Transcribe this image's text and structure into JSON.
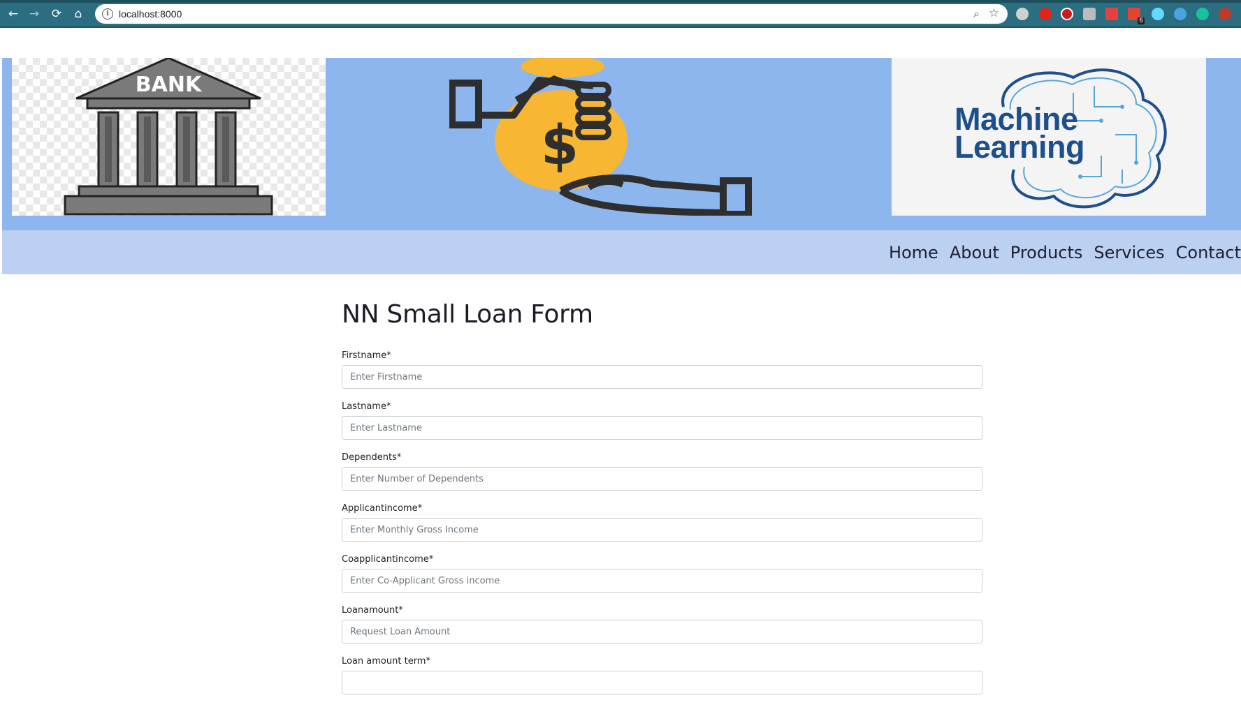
{
  "browser": {
    "url": "localhost:8000",
    "extensions": [
      {
        "name": "wolf-extension-icon",
        "color": "#cfcfcf"
      },
      {
        "name": "red-extension-icon",
        "color": "#e0241b"
      },
      {
        "name": "adblock-icon",
        "color": "#d11a1a"
      },
      {
        "name": "pdf-tool-icon",
        "color": "#bbbbbb"
      },
      {
        "name": "red-square-extension-icon",
        "color": "#e84040"
      },
      {
        "name": "todoist-icon",
        "color": "#e44332"
      },
      {
        "name": "react-devtools-icon",
        "color": "#61dafb"
      },
      {
        "name": "cloud-extension-icon",
        "color": "#4aa3e0"
      },
      {
        "name": "grammarly-icon",
        "color": "#15c39a"
      },
      {
        "name": "red-dot-extension-icon",
        "color": "#c0392b"
      }
    ],
    "extension_badge": "6"
  },
  "banner": {
    "bank_sign": "BANK",
    "ml_logo": [
      "Machine",
      "Learning"
    ]
  },
  "nav": {
    "items": [
      "Home",
      "About",
      "Products",
      "Services",
      "Contact"
    ]
  },
  "form": {
    "title": "NN Small Loan Form",
    "fields": [
      {
        "label": "Firstname*",
        "placeholder": "Enter Firstname"
      },
      {
        "label": "Lastname*",
        "placeholder": "Enter Lastname"
      },
      {
        "label": "Dependents*",
        "placeholder": "Enter Number of Dependents"
      },
      {
        "label": "Applicantincome*",
        "placeholder": "Enter Monthly Gross Income"
      },
      {
        "label": "Coapplicantincome*",
        "placeholder": "Enter Co-Applicant Gross income"
      },
      {
        "label": "Loanamount*",
        "placeholder": "Request Loan Amount"
      },
      {
        "label": "Loan amount term*",
        "placeholder": ""
      }
    ]
  },
  "colors": {
    "banner_bg": "#8eb6ee",
    "nav_bg": "#bcd0f2",
    "chrome_bg": "#2b6e82",
    "coin_yellow": "#f7b733",
    "ml_blue": "#1d4f8c"
  }
}
